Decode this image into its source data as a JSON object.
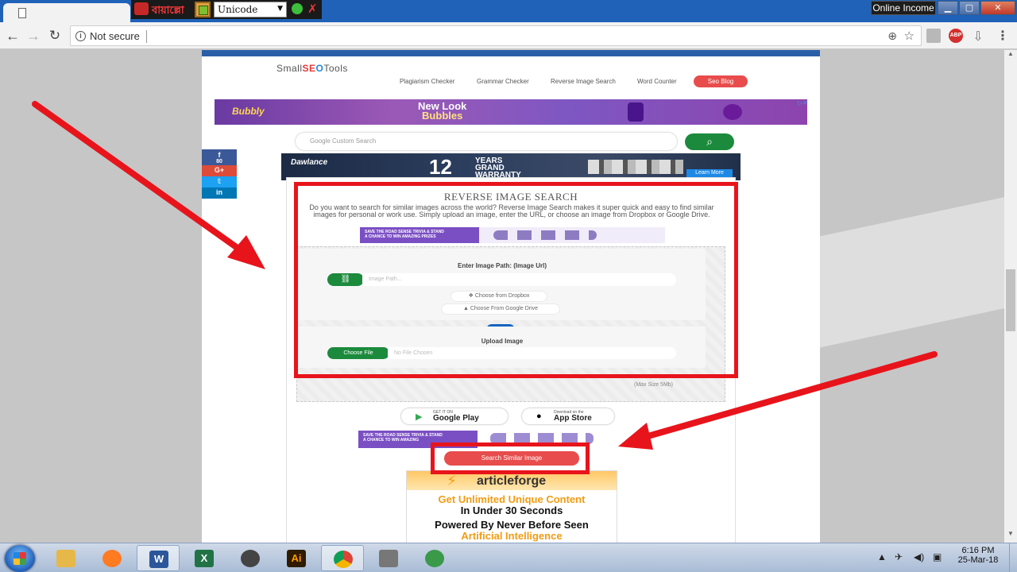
{
  "langbar": {
    "app_name": "বায়াল্লো",
    "encoding": "Unicode"
  },
  "window": {
    "label": "Online Income"
  },
  "addressbar": {
    "security_label": "Not secure"
  },
  "site": {
    "logo_parts": [
      "Small",
      "SE",
      "O",
      "Tools"
    ],
    "nav": {
      "plagiarism": "Plagiarism Checker",
      "grammar": "Grammar Checker",
      "reverse": "Reverse Image Search",
      "word": "Word Counter",
      "blog": "Seo Blog"
    },
    "search_label": "Google Custom Search",
    "social_fb_count": "80"
  },
  "ads": {
    "bubbly_brand": "Bubbly",
    "bubbly_line1": "New Look",
    "bubbly_line2": "Bubbles",
    "dawlance_brand": "Dawlance",
    "dawlance_number": "12",
    "dawlance_years": "YEARS",
    "dawlance_grand": "GRAND",
    "dawlance_warranty": "WARRANTY",
    "dawlance_cta": "Learn More",
    "road_text1": "SAVE THE ROAD SENSE TRIVIA & STAND",
    "road_text2": "A CHANCE TO WIN AMAZING PRIZES",
    "road2_text2": "A CHANCE TO WIN AMAZING",
    "af_logo": "articleforge",
    "af_line1": "Get Unlimited Unique Content",
    "af_line2": "In Under 30 Seconds",
    "af_line3": "Powered By Never Before Seen",
    "af_line4": "Artificial Intelligence"
  },
  "tool": {
    "title": "REVERSE IMAGE SEARCH",
    "description": "Do you want to search for similar images across the world? Reverse Image Search makes it super quick and easy to find similar images for personal or work use. Simply upload an image, enter the URL, or choose an image from Dropbox or Google Drive.",
    "url_heading": "Enter Image Path: (Image Url)",
    "url_placeholder": "Image Path...",
    "dropbox_label": "Choose from Dropbox",
    "gdrive_label": "Choose From Google Drive",
    "or_label": "OR",
    "upload_heading": "Upload Image",
    "choose_file_label": "Choose File",
    "no_file_label": "No File Chosen",
    "max_size": "(Max Size 5Mb)",
    "google_play_small": "GET IT ON",
    "google_play_big": "Google Play",
    "app_store_small": "Download on the",
    "app_store_big": "App Store",
    "search_button": "Search Similar Image"
  },
  "taskbar": {
    "time": "6:16 PM",
    "date": "25-Mar-18",
    "ai_label": "Ai"
  },
  "icons": {
    "back": "arrow-left",
    "forward": "arrow-right",
    "reload": "reload",
    "info": "info-circle",
    "zoom": "magnifier",
    "star": "star",
    "menu": "vertical-dots",
    "search": "magnifier",
    "link": "chain-link",
    "dropbox": "dropbox",
    "gdrive": "google-drive"
  },
  "colors": {
    "highlight": "#e8141b",
    "accent_green": "#1b8a3c",
    "accent_red": "#e84c4c",
    "accent_blue": "#1565c0"
  }
}
